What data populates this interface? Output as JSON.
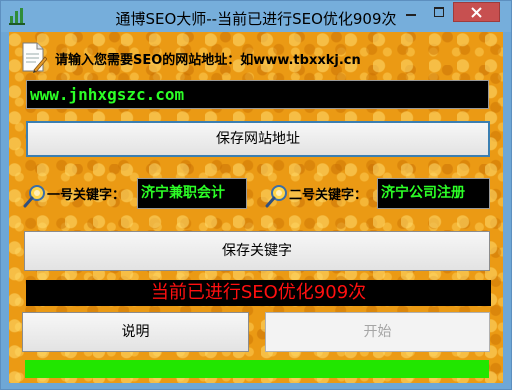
{
  "window": {
    "title": "通博SEO大师--当前已进行SEO优化909次"
  },
  "header": {
    "prompt": "请输入您需要SEO的网站地址：如www.tbxxkj.cn"
  },
  "url_field": {
    "value": "www.jnhxgszc.com"
  },
  "buttons": {
    "save_url": "保存网站地址",
    "save_keywords": "保存关键字",
    "help": "说明",
    "start": "开始"
  },
  "keywords": {
    "kw1": {
      "label": "一号关键字：",
      "value": "济宁兼职会计"
    },
    "kw2": {
      "label": "二号关键字：",
      "value": "济宁公司注册"
    }
  },
  "status": {
    "text": "当前已进行SEO优化909次"
  },
  "progress": {
    "fraction": 1.0
  },
  "icons": [
    "app-icon",
    "minimize-icon",
    "maximize-icon",
    "close-icon",
    "document-pencil-icon",
    "key-magnifier-icon"
  ],
  "colors": {
    "background": "#eb9a14",
    "field_text": "#2cff26",
    "status_text": "#ff1010",
    "progress": "#21e600"
  }
}
